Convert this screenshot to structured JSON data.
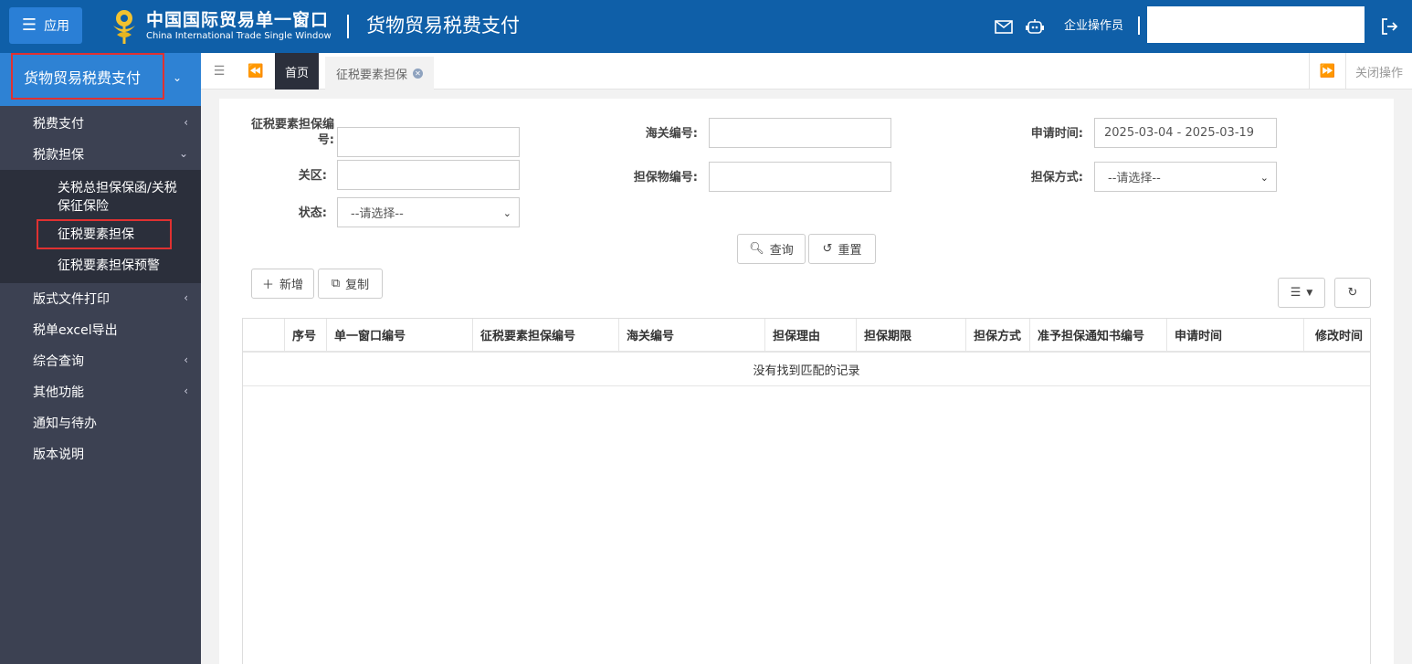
{
  "header": {
    "app_label": "应用",
    "brand_cn": "中国国际贸易单一窗口",
    "brand_en": "China International Trade Single Window",
    "title": "货物贸易税费支付",
    "user_label": "企业操作员",
    "user_box_value": ""
  },
  "sidebar": {
    "title": "货物贸易税费支付",
    "items": [
      {
        "label": "税费支付"
      },
      {
        "label": "税款担保"
      },
      {
        "label": "版式文件打印"
      },
      {
        "label": "税单excel导出"
      },
      {
        "label": "综合查询"
      },
      {
        "label": "其他功能"
      },
      {
        "label": "通知与待办"
      },
      {
        "label": "版本说明"
      }
    ],
    "submenu": [
      {
        "label": "关税总担保保函/关税保征保险"
      },
      {
        "label": "征税要素担保"
      },
      {
        "label": "征税要素担保预警"
      }
    ]
  },
  "tabs": {
    "home": "首页",
    "current": "征税要素担保",
    "close_ops": "关闭操作"
  },
  "form": {
    "guarantee_no_label": "征税要素担保编号:",
    "customs_no_label": "海关编号:",
    "apply_time_label": "申请时间:",
    "apply_time_value": "2025-03-04 - 2025-03-19",
    "area_label": "关区:",
    "collateral_no_label": "担保物编号:",
    "guarantee_type_label": "担保方式:",
    "guarantee_type_value": "--请选择--",
    "status_label": "状态:",
    "status_value": "--请选择--",
    "query_btn": "查询",
    "reset_btn": "重置"
  },
  "toolbar": {
    "add_btn": "新增",
    "copy_btn": "复制"
  },
  "table": {
    "columns": [
      "",
      "序号",
      "单一窗口编号",
      "征税要素担保编号",
      "海关编号",
      "担保理由",
      "担保期限",
      "担保方式",
      "准予担保通知书编号",
      "申请时间",
      "修改时间"
    ],
    "empty_text": "没有找到匹配的记录"
  }
}
